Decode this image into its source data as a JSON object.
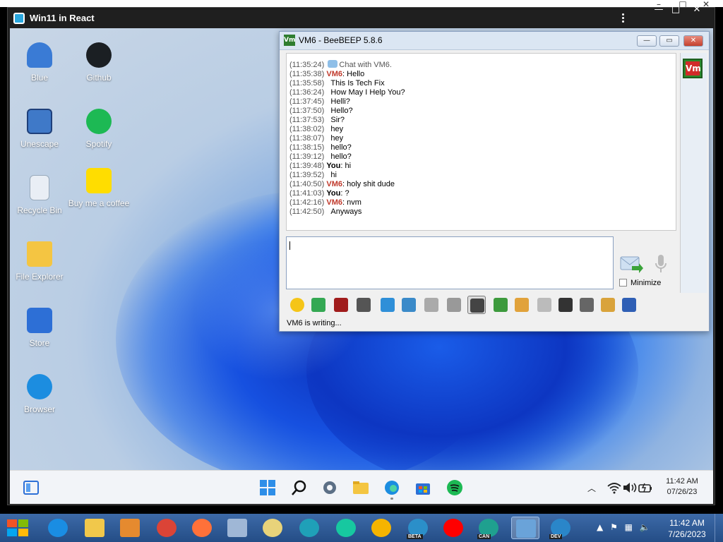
{
  "host": {
    "win_min": "–",
    "win_max": "□",
    "win_close": "✕"
  },
  "app": {
    "title": "Win11 in React",
    "min": "—",
    "max": "□",
    "close": "✕"
  },
  "desktop_icons": [
    {
      "label": "Blue",
      "color": "#3a7bd5"
    },
    {
      "label": "Github",
      "color": "#1b1f23"
    },
    {
      "label": "Unescape",
      "color": "#3f79c8"
    },
    {
      "label": "Spotify",
      "color": "#1db954"
    },
    {
      "label": "Recycle Bin",
      "color": "#e9eef5"
    },
    {
      "label": "Buy me a coffee",
      "color": "#ffdd00"
    },
    {
      "label": "File Explorer",
      "color": "#f4c542"
    },
    {
      "label": "Store",
      "color": "#2d6fd6"
    },
    {
      "label": "Browser",
      "color": "#1c8de0"
    }
  ],
  "bee": {
    "title": "VM6 - BeeBEEP 5.8.6",
    "logo": "Vm",
    "min": "—",
    "max": "▭",
    "close": "✕",
    "side_icon": "Vm",
    "minimize_label": "Minimize",
    "status": "VM6 is writing...",
    "messages": [
      {
        "ts": "(11:35:24)",
        "who": "",
        "text": "Chat with VM6.",
        "system": true
      },
      {
        "ts": "(11:35:38)",
        "who": "VM6",
        "text": ": Hello"
      },
      {
        "ts": "(11:35:58)",
        "who": "",
        "text": "This Is Tech Fix"
      },
      {
        "ts": "(11:36:24)",
        "who": "",
        "text": "How May I Help You?"
      },
      {
        "ts": "(11:37:45)",
        "who": "",
        "text": "Helli?"
      },
      {
        "ts": "(11:37:50)",
        "who": "",
        "text": "Hello?"
      },
      {
        "ts": "(11:37:53)",
        "who": "",
        "text": "Sir?"
      },
      {
        "ts": "(11:38:02)",
        "who": "",
        "text": "hey"
      },
      {
        "ts": "(11:38:07)",
        "who": "",
        "text": "hey"
      },
      {
        "ts": "(11:38:15)",
        "who": "",
        "text": "hello?"
      },
      {
        "ts": "(11:39:12)",
        "who": "",
        "text": "hello?"
      },
      {
        "ts": "(11:39:48)",
        "who": "You",
        "text": ": hi"
      },
      {
        "ts": "(11:39:52)",
        "who": "",
        "text": "hi"
      },
      {
        "ts": "(11:40:50)",
        "who": "VM6",
        "text": ": holy shit dude"
      },
      {
        "ts": "(11:41:03)",
        "who": "You",
        "text": ": ?"
      },
      {
        "ts": "(11:42:16)",
        "who": "VM6",
        "text": ": nvm"
      },
      {
        "ts": "(11:42:50)",
        "who": "",
        "text": "Anyways"
      }
    ],
    "tools": [
      {
        "name": "emoticon-icon",
        "color": "#f5c518"
      },
      {
        "name": "message-icon",
        "color": "#34a853"
      },
      {
        "name": "font-icon",
        "color": "#a01c1c"
      },
      {
        "name": "color-palette-icon",
        "color": "#555"
      },
      {
        "name": "filter-icon",
        "color": "#2f8fd8"
      },
      {
        "name": "settings-icon",
        "color": "#3a8ac9"
      },
      {
        "name": "spellcheck-icon",
        "color": "#aaaaaa"
      },
      {
        "name": "dictionary-icon",
        "color": "#999999"
      },
      {
        "name": "note-icon",
        "color": "#444444"
      },
      {
        "name": "export-icon",
        "color": "#3d9a3d"
      },
      {
        "name": "send-file-icon",
        "color": "#e1a23b"
      },
      {
        "name": "html-icon",
        "color": "#bbbbbb"
      },
      {
        "name": "webcam-icon",
        "color": "#333333"
      },
      {
        "name": "screenshot-icon",
        "color": "#666666"
      },
      {
        "name": "edit-icon",
        "color": "#d9a33b"
      },
      {
        "name": "save-icon",
        "color": "#2f5fb5"
      }
    ]
  },
  "inner_taskbar": {
    "time": "11:42 AM",
    "date": "07/26/23"
  },
  "host_taskbar": {
    "time": "11:42 AM",
    "date": "7/26/2023",
    "apps": [
      {
        "name": "ie-taskbar-icon",
        "color": "#1a8de3",
        "badge": ""
      },
      {
        "name": "folder-taskbar-icon",
        "color": "#f1c84b",
        "badge": ""
      },
      {
        "name": "media-player-taskbar-icon",
        "color": "#e58a2f",
        "badge": ""
      },
      {
        "name": "chrome-taskbar-icon",
        "color": "#db4437",
        "badge": ""
      },
      {
        "name": "firefox-taskbar-icon",
        "color": "#ff7139",
        "badge": ""
      },
      {
        "name": "remote-desktop-taskbar-icon",
        "color": "#9fb7d6",
        "badge": ""
      },
      {
        "name": "beebeep-taskbar-icon",
        "color": "#e8d37a",
        "badge": ""
      },
      {
        "name": "edge-taskbar-icon",
        "color": "#1fa0b8",
        "badge": ""
      },
      {
        "name": "opera-gx-taskbar-icon",
        "color": "#17c8a0",
        "badge": ""
      },
      {
        "name": "chrome-canary-taskbar-icon",
        "color": "#f5b400",
        "badge": ""
      },
      {
        "name": "edge-beta-taskbar-icon",
        "color": "#2b8fc9",
        "badge": "BETA"
      },
      {
        "name": "youtube-taskbar-icon",
        "color": "#ff0000",
        "badge": ""
      },
      {
        "name": "edge-canary-taskbar-icon",
        "color": "#1fa08f",
        "badge": "CAN"
      },
      {
        "name": "virtual-machine-taskbar-icon",
        "color": "#6aa3d9",
        "badge": ""
      },
      {
        "name": "edge-dev-taskbar-icon",
        "color": "#2a86c9",
        "badge": "DEV"
      }
    ]
  }
}
